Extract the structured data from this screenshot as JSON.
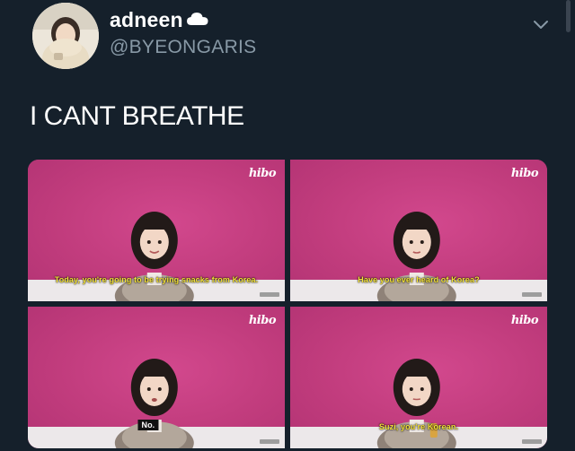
{
  "user": {
    "display_name": "adneen",
    "handle": "@BYEONGARIS"
  },
  "tweet": {
    "text": "I CANT BREATHE"
  },
  "media": {
    "logo": "hibo",
    "frames": [
      {
        "subtitle": "Today, you're going to be trying snacks from Korea."
      },
      {
        "subtitle": "Have you ever heard of Korea?"
      },
      {
        "subtitle": "No."
      },
      {
        "subtitle": "Suzi, you're Korean."
      }
    ]
  },
  "colors": {
    "background": "#15202b",
    "secondary_text": "#8899a6",
    "video_backdrop": "#c83b81",
    "subtitle_yellow": "#f5e23a"
  },
  "icons": [
    "cloud-icon",
    "chevron-down-icon"
  ]
}
